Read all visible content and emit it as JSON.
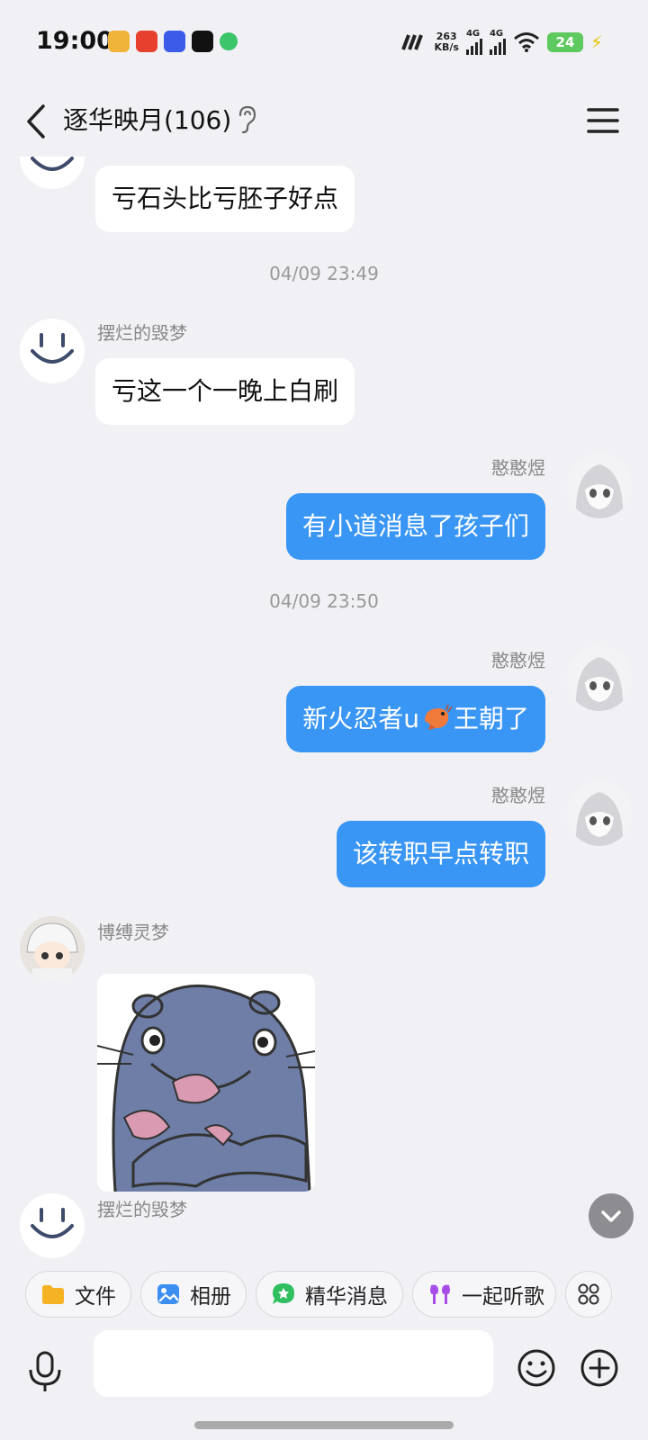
{
  "status_bar": {
    "time": "19:00",
    "net_speed_value": "263",
    "net_speed_unit": "KB/s",
    "signal1_label": "4G",
    "signal2_label": "4G",
    "battery": "24"
  },
  "header": {
    "title": "逐华映月(106)"
  },
  "messages": [
    {
      "side": "in",
      "text": "亏石头比亏胚子好点"
    },
    {
      "timestamp": "04/09 23:49"
    },
    {
      "side": "in",
      "sender": "摆烂的毁梦",
      "text": "亏这一个一晚上白刷"
    },
    {
      "side": "out",
      "sender": "憨憨煜",
      "text": "有小道消息了孩子们"
    },
    {
      "timestamp": "04/09 23:50"
    },
    {
      "side": "out",
      "sender": "憨憨煜",
      "text_before": "新火忍者u",
      "text_after": "王朝了"
    },
    {
      "side": "out",
      "sender": "憨憨煜",
      "text": "该转职早点转职"
    },
    {
      "side": "in",
      "sender": "博缚灵梦",
      "sticker": "cartoon-otter-sticker"
    },
    {
      "side": "in",
      "sender": "摆烂的毁梦"
    }
  ],
  "toolbar": {
    "file_label": "文件",
    "album_label": "相册",
    "essence_label": "精华消息",
    "listen_label": "一起听歌"
  },
  "input": {
    "placeholder": ""
  },
  "colors": {
    "outgoing_bubble": "#3a96f5",
    "incoming_bubble": "#ffffff",
    "background": "#f1f1f5"
  }
}
